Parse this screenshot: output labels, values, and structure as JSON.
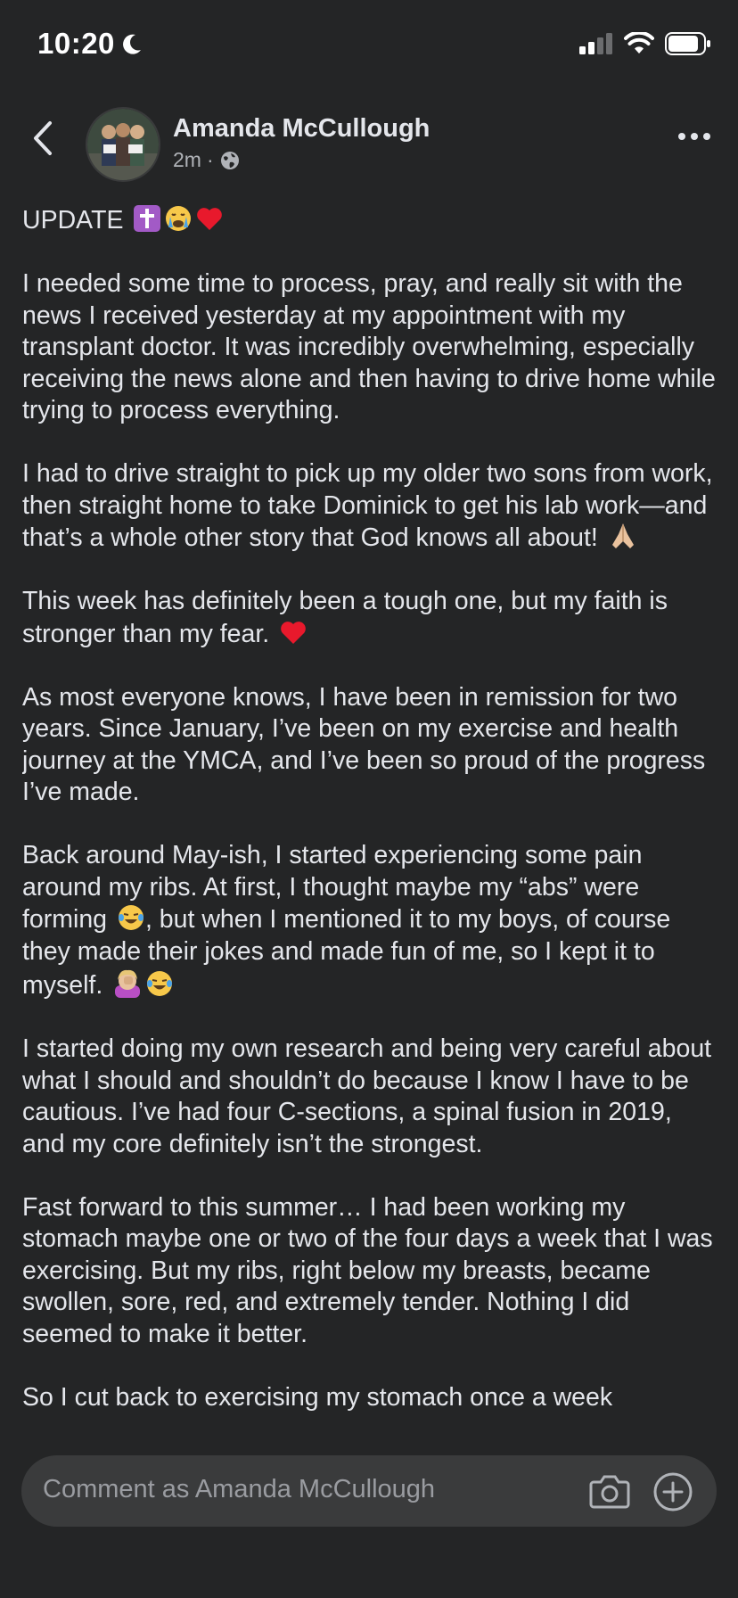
{
  "status": {
    "time": "10:20"
  },
  "post": {
    "author": "Amanda McCullough",
    "time_ago": "2m",
    "separator": "·",
    "paragraphs": [
      "UPDATE",
      "I needed some time to process, pray, and really sit with the news I received yesterday at my appointment with my transplant doctor. It was incredibly overwhelming, especially receiving the news alone and then having to drive home while trying to process everything.",
      "I had to drive straight to pick up my older two sons from work, then straight home to take Dominick to get his lab work—and that’s a whole other story that God knows all about!",
      "This week has definitely been a tough one, but my faith is stronger than my fear.",
      "As most everyone knows, I have been in remission for two years. Since January, I’ve been on my exercise and health journey at the YMCA, and I’ve been so proud of the progress I’ve made.",
      "Back around May-ish, I started experiencing some pain around my ribs. At first, I thought maybe my “abs” were forming",
      ", but when I mentioned it to my boys, of course they made their jokes and made fun of me, so I kept it to myself.",
      "I started doing my own research and being very careful about what I should and shouldn’t do because I know I have to be cautious. I’ve had four C-sections, a spinal fusion in 2019, and my core definitely isn’t the strongest.",
      "Fast forward to this summer… I had been working my stomach maybe one or two of the four days a week that I was exercising. But my ribs, right below my breasts, became swollen, sore, red, and extremely tender. Nothing I did seemed to make it better.",
      "So I cut back to exercising my stomach once a week"
    ]
  },
  "comment": {
    "placeholder": "Comment as Amanda McCullough"
  },
  "icons": [
    "moon-icon",
    "signal-icon",
    "wifi-icon",
    "battery-icon",
    "back-chevron-icon",
    "globe-icon",
    "more-icon",
    "cross-emoji",
    "crying-emoji",
    "heart-emoji",
    "praying-hands-emoji",
    "laughing-emoji",
    "facepalm-emoji",
    "camera-icon",
    "add-circle-icon"
  ],
  "colors": {
    "background": "#242526",
    "text": "#e4e6eb",
    "muted": "#b0b3b8",
    "input": "#3a3b3c"
  }
}
